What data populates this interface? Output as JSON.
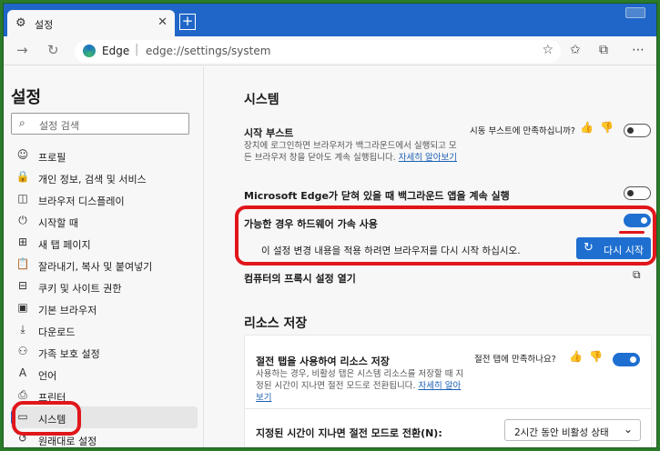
{
  "browser": {
    "tab_title": "설정",
    "tab_close": "✕",
    "new_tab": "+",
    "brand": "Edge",
    "url": "edge://settings/system"
  },
  "sidebar": {
    "title": "설정",
    "search_placeholder": "설정 검색",
    "items": [
      {
        "label": "프로필",
        "icon": "profile-icon",
        "glyph": "☺"
      },
      {
        "label": "개인 정보, 검색 및 서비스",
        "icon": "lock-icon",
        "glyph": "🔒"
      },
      {
        "label": "브라우저 디스플레이",
        "icon": "display-icon",
        "glyph": "◫"
      },
      {
        "label": "시작할 때",
        "icon": "power-icon",
        "glyph": "⏻"
      },
      {
        "label": "새 탭 페이지",
        "icon": "newtab-icon",
        "glyph": "⊞"
      },
      {
        "label": "잘라내기, 복사 및 붙여넣기",
        "icon": "clipboard-icon",
        "glyph": "📋"
      },
      {
        "label": "쿠키 및 사이트 권한",
        "icon": "cookie-icon",
        "glyph": "⊟"
      },
      {
        "label": "기본 브라우저",
        "icon": "browser-icon",
        "glyph": "▣"
      },
      {
        "label": "다운로드",
        "icon": "download-icon",
        "glyph": "⤓"
      },
      {
        "label": "가족 보호 설정",
        "icon": "family-icon",
        "glyph": "⚇"
      },
      {
        "label": "언어",
        "icon": "language-icon",
        "glyph": "A"
      },
      {
        "label": "프린터",
        "icon": "printer-icon",
        "glyph": "⎙"
      },
      {
        "label": "시스템",
        "icon": "laptop-icon",
        "glyph": "▭"
      },
      {
        "label": "원래대로 설정",
        "icon": "reset-icon",
        "glyph": "↺"
      }
    ]
  },
  "system": {
    "heading": "시스템",
    "startup_boost": {
      "title": "시작 부스트",
      "desc": "장치에 로그인하면 브라우저가 백그라운드에서 실행되고 모든 브라우저 창을 닫아도 계속 실행됩니다.",
      "link": "자세히 알아보기",
      "feedback": "시동 부스트에 만족하십니까?",
      "enabled": false
    },
    "background_apps": {
      "title": "Microsoft Edge가 닫혀 있을 때 백그라운드 앱을 계속 실행",
      "enabled": false
    },
    "hardware_accel": {
      "title": "가능한 경우 하드웨어 가속 사용",
      "enabled": true,
      "restart_msg": "이 설정 변경 내용을 적용 하려면 브라우저를 다시 시작 하십시오.",
      "restart_label": "다시 시작"
    },
    "proxy": {
      "title": "컴퓨터의 프록시 설정 열기"
    }
  },
  "resources": {
    "heading": "리소스 저장",
    "sleeping_tabs": {
      "title": "절전 탭을 사용하여 리소스 저장",
      "desc": "사용하는 경우, 비활성 탭은 시스템 리소스를 저장할 때 지정된 시간이 지나면 절전 모드로 전환됩니다.",
      "link": "자세히 알아보기",
      "feedback": "절전 탭에 만족하나요?",
      "enabled": true
    },
    "sleep_after": {
      "label": "지정된 시간이 지나면 절전 모드로 전환(N):",
      "value": "2시간 동안 비활성 상태"
    }
  },
  "colors": {
    "accent": "#1f6fd1",
    "titlebar": "#1f66c8",
    "highlight": "#e0161b"
  }
}
